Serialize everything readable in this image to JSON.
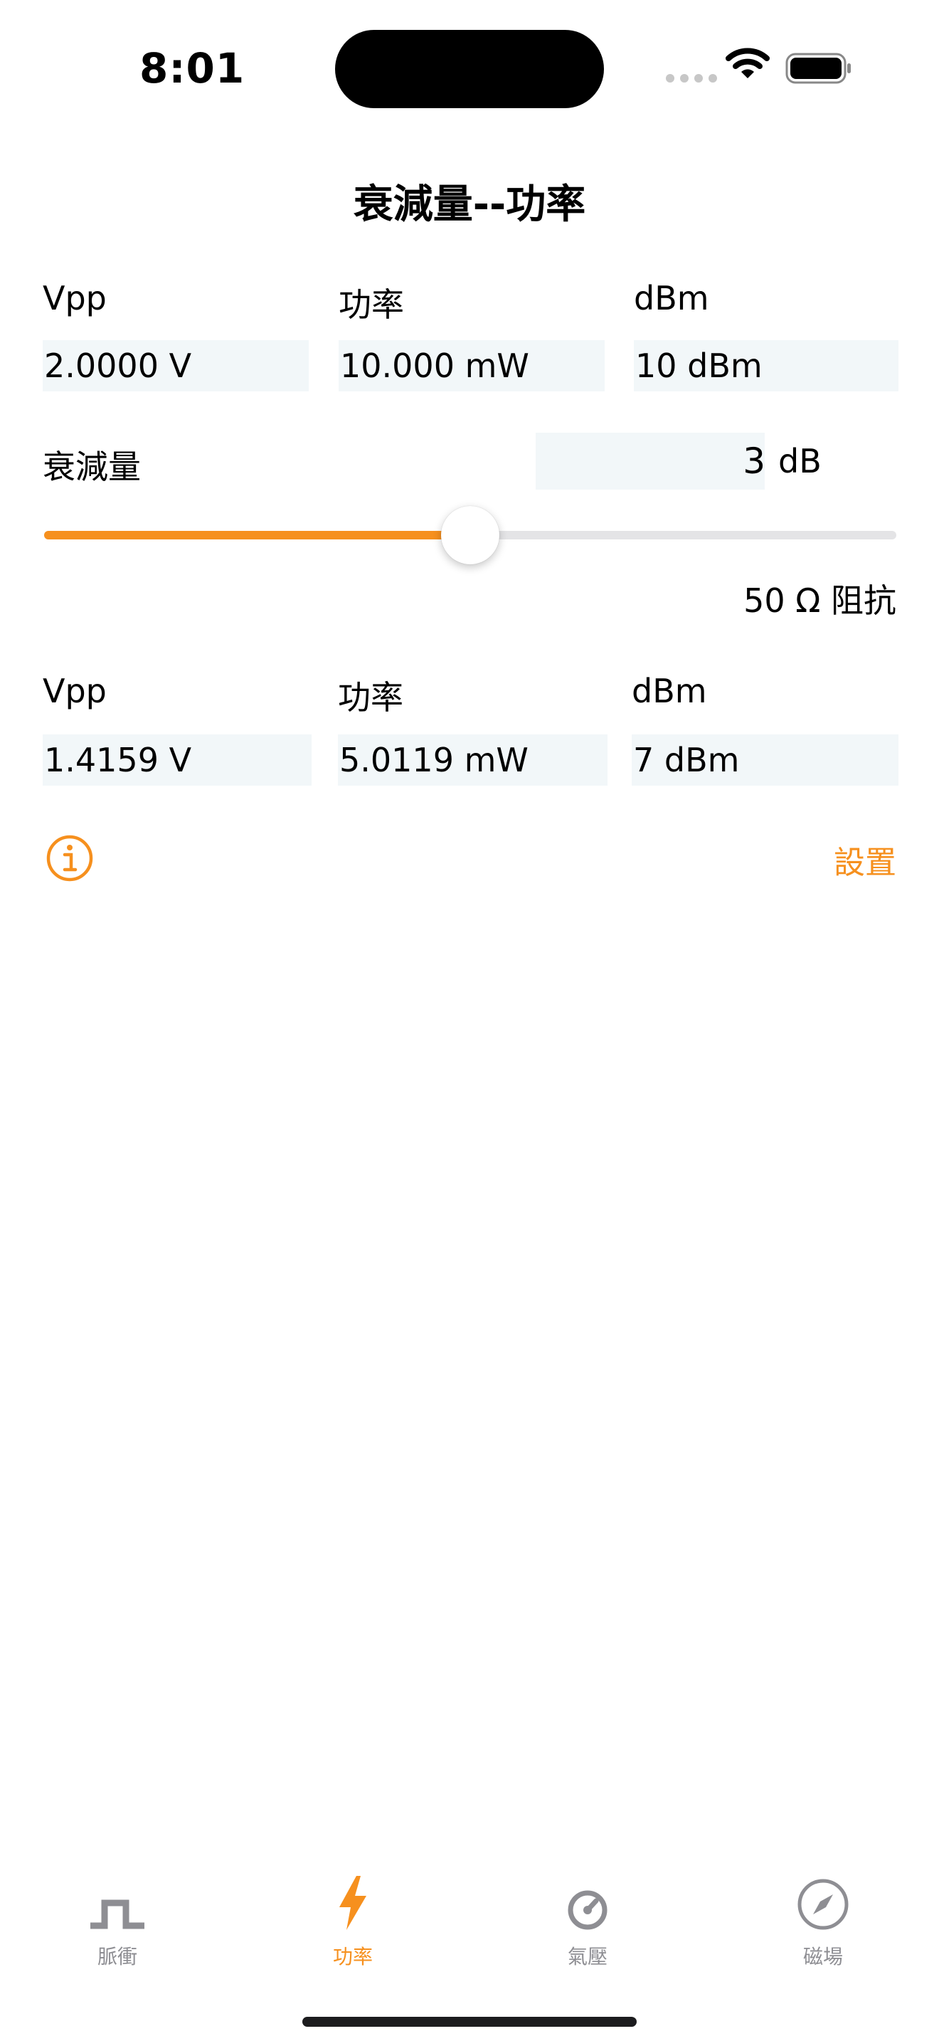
{
  "status": {
    "time": "8:01"
  },
  "title": "衰減量--功率",
  "input": {
    "labels": [
      "Vpp",
      "功率",
      "dBm"
    ],
    "values": [
      "2.0000 V",
      "10.000 mW",
      "10 dBm"
    ]
  },
  "attenuation": {
    "label": "衰減量",
    "value": "3",
    "unit": "dB",
    "slider_fraction": 0.5
  },
  "impedance": "50 Ω 阻抗",
  "output": {
    "labels": [
      "Vpp",
      "功率",
      "dBm"
    ],
    "values": [
      "1.4159 V",
      "5.0119 mW",
      "7 dBm"
    ]
  },
  "settings_label": "設置",
  "colors": {
    "accent": "#f6901e",
    "field_bg": "#f2f7f9",
    "inactive": "#8e8e93"
  },
  "tabs": [
    {
      "label": "脈衝",
      "icon": "pulse-icon",
      "active": false
    },
    {
      "label": "功率",
      "icon": "bolt-icon",
      "active": true
    },
    {
      "label": "氣壓",
      "icon": "gauge-icon",
      "active": false
    },
    {
      "label": "磁場",
      "icon": "compass-icon",
      "active": false
    }
  ]
}
